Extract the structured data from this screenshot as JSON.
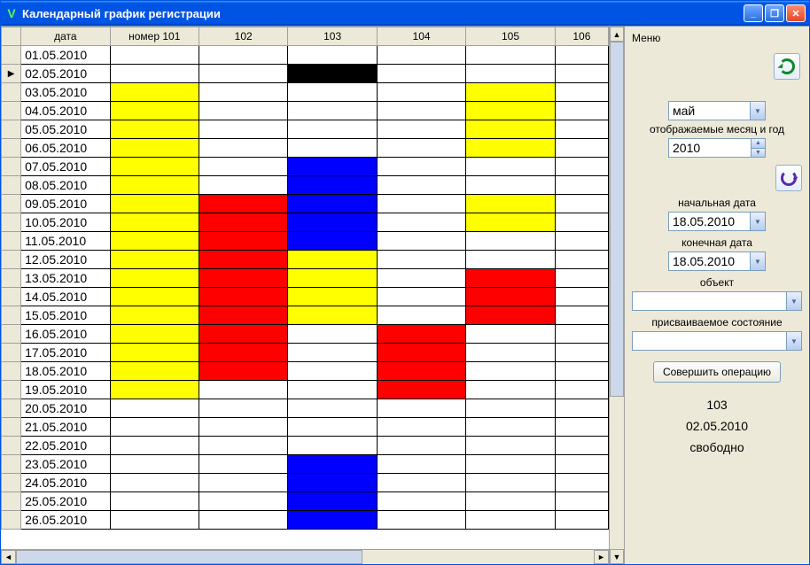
{
  "window": {
    "title": "Календарный график регистрации"
  },
  "grid": {
    "headers": [
      "дата",
      "номер 101",
      "102",
      "103",
      "104",
      "105",
      "106"
    ],
    "rows": [
      {
        "date": "01.05.2010",
        "marker": "",
        "cells": [
          "",
          "",
          "",
          "",
          "",
          ""
        ]
      },
      {
        "date": "02.05.2010",
        "marker": "▶",
        "cells": [
          "",
          "",
          "black",
          "",
          "",
          ""
        ]
      },
      {
        "date": "03.05.2010",
        "marker": "",
        "cells": [
          "yellow",
          "",
          "",
          "",
          "yellow",
          ""
        ]
      },
      {
        "date": "04.05.2010",
        "marker": "",
        "cells": [
          "yellow",
          "",
          "",
          "",
          "yellow",
          ""
        ]
      },
      {
        "date": "05.05.2010",
        "marker": "",
        "cells": [
          "yellow",
          "",
          "",
          "",
          "yellow",
          ""
        ]
      },
      {
        "date": "06.05.2010",
        "marker": "",
        "cells": [
          "yellow",
          "",
          "",
          "",
          "yellow",
          ""
        ]
      },
      {
        "date": "07.05.2010",
        "marker": "",
        "cells": [
          "yellow",
          "",
          "blue",
          "",
          "",
          ""
        ]
      },
      {
        "date": "08.05.2010",
        "marker": "",
        "cells": [
          "yellow",
          "",
          "blue",
          "",
          "",
          ""
        ]
      },
      {
        "date": "09.05.2010",
        "marker": "",
        "cells": [
          "yellow",
          "red",
          "blue",
          "",
          "yellow",
          ""
        ]
      },
      {
        "date": "10.05.2010",
        "marker": "",
        "cells": [
          "yellow",
          "red",
          "blue",
          "",
          "yellow",
          ""
        ]
      },
      {
        "date": "11.05.2010",
        "marker": "",
        "cells": [
          "yellow",
          "red",
          "blue",
          "",
          "",
          ""
        ]
      },
      {
        "date": "12.05.2010",
        "marker": "",
        "cells": [
          "yellow",
          "red",
          "yellow",
          "",
          "",
          ""
        ]
      },
      {
        "date": "13.05.2010",
        "marker": "",
        "cells": [
          "yellow",
          "red",
          "yellow",
          "",
          "red",
          ""
        ]
      },
      {
        "date": "14.05.2010",
        "marker": "",
        "cells": [
          "yellow",
          "red",
          "yellow",
          "",
          "red",
          ""
        ]
      },
      {
        "date": "15.05.2010",
        "marker": "",
        "cells": [
          "yellow",
          "red",
          "yellow",
          "",
          "red",
          ""
        ]
      },
      {
        "date": "16.05.2010",
        "marker": "",
        "cells": [
          "yellow",
          "red",
          "",
          "red",
          "",
          ""
        ]
      },
      {
        "date": "17.05.2010",
        "marker": "",
        "cells": [
          "yellow",
          "red",
          "",
          "red",
          "",
          ""
        ]
      },
      {
        "date": "18.05.2010",
        "marker": "",
        "cells": [
          "yellow",
          "red",
          "",
          "red",
          "",
          ""
        ]
      },
      {
        "date": "19.05.2010",
        "marker": "",
        "cells": [
          "yellow",
          "",
          "",
          "red",
          "",
          ""
        ]
      },
      {
        "date": "20.05.2010",
        "marker": "",
        "cells": [
          "",
          "",
          "",
          "",
          "",
          ""
        ]
      },
      {
        "date": "21.05.2010",
        "marker": "",
        "cells": [
          "",
          "",
          "",
          "",
          "",
          ""
        ]
      },
      {
        "date": "22.05.2010",
        "marker": "",
        "cells": [
          "",
          "",
          "",
          "",
          "",
          ""
        ]
      },
      {
        "date": "23.05.2010",
        "marker": "",
        "cells": [
          "",
          "",
          "blue",
          "",
          "",
          ""
        ]
      },
      {
        "date": "24.05.2010",
        "marker": "",
        "cells": [
          "",
          "",
          "blue",
          "",
          "",
          ""
        ]
      },
      {
        "date": "25.05.2010",
        "marker": "",
        "cells": [
          "",
          "",
          "blue",
          "",
          "",
          ""
        ]
      },
      {
        "date": "26.05.2010",
        "marker": "",
        "cells": [
          "",
          "",
          "blue",
          "",
          "",
          ""
        ]
      }
    ]
  },
  "side": {
    "menu": "Меню",
    "month_value": "май",
    "month_year_label": "отображаемые месяц и год",
    "year_value": "2010",
    "start_date_label": "начальная дата",
    "start_date_value": "18.05.2010",
    "end_date_label": "конечная дата",
    "end_date_value": "18.05.2010",
    "object_label": "объект",
    "object_value": "",
    "state_label": "присваиваемое состояние",
    "state_value": "",
    "action_button": "Совершить операцию",
    "status_room": "103",
    "status_date": "02.05.2010",
    "status_state": "свободно"
  }
}
